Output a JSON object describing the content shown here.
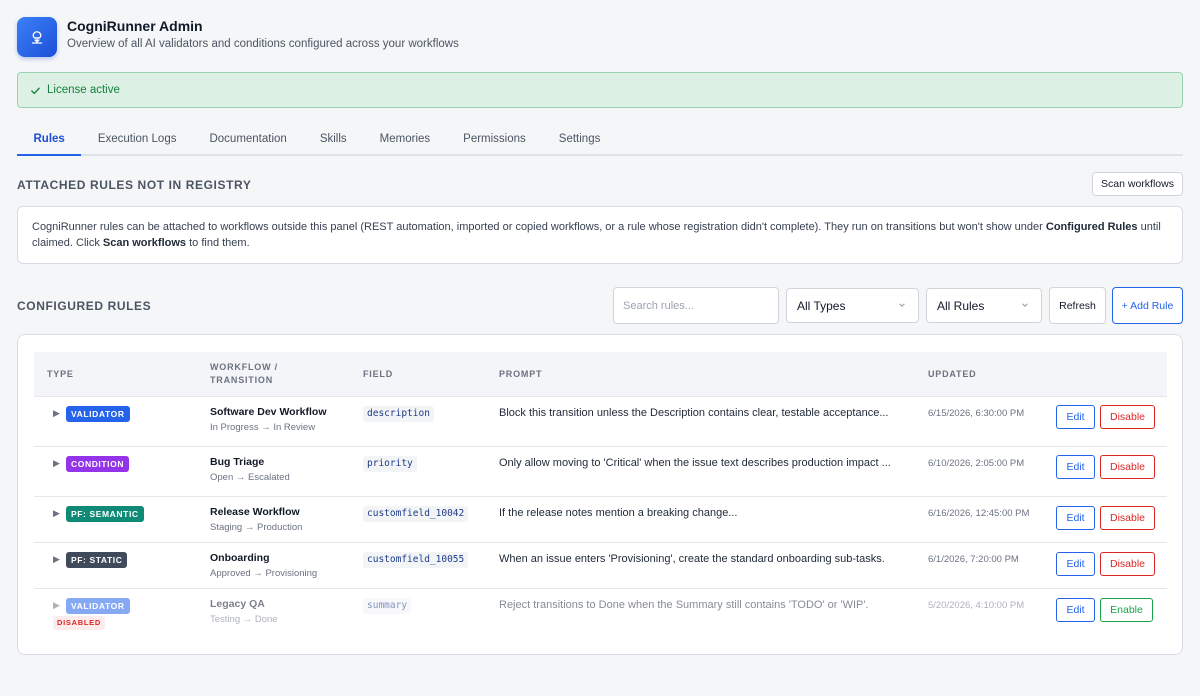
{
  "app": {
    "title": "CogniRunner Admin",
    "subtitle": "Overview of all AI validators and conditions configured across your workflows"
  },
  "license": {
    "text": "License active",
    "color": "#15803d"
  },
  "tabs": [
    {
      "label": "Rules",
      "active": true
    },
    {
      "label": "Execution Logs"
    },
    {
      "label": "Documentation"
    },
    {
      "label": "Skills"
    },
    {
      "label": "Memories"
    },
    {
      "label": "Permissions"
    },
    {
      "label": "Settings"
    }
  ],
  "attached": {
    "title": "ATTACHED RULES NOT IN REGISTRY",
    "scan_button": "Scan workflows",
    "info_part1": "CogniRunner rules can be attached to workflows outside this panel (REST automation, imported or copied workflows, or a rule whose registration didn't complete). They run on transitions but won't show under ",
    "info_bold1": "Configured Rules",
    "info_part2": " until claimed. Click ",
    "info_bold2": "Scan workflows",
    "info_part3": " to find them."
  },
  "configured": {
    "title": "CONFIGURED RULES",
    "search_placeholder": "Search rules...",
    "type_filter": "All Types",
    "rule_filter": "All Rules",
    "refresh_button": "Refresh",
    "add_button": "+ Add Rule",
    "accent_color": "#2563eb"
  },
  "table": {
    "headers": {
      "type": "TYPE",
      "workflow_line1": "WORKFLOW /",
      "workflow_line2": "TRANSITION",
      "field": "FIELD",
      "prompt": "PROMPT",
      "updated": "UPDATED"
    },
    "rows": [
      {
        "type": "VALIDATOR",
        "type_color": "#2563eb",
        "workflow": "Software Dev Workflow",
        "transition": "In Progress → In Review",
        "field": "description",
        "prompt": "Block this transition unless the Description contains clear, testable acceptance...",
        "updated": "6/15/2026, 6:30:00 PM",
        "edit": "Edit",
        "action": "Disable"
      },
      {
        "type": "CONDITION",
        "type_color": "#9333ea",
        "workflow": "Bug Triage",
        "transition": "Open → Escalated",
        "field": "priority",
        "prompt": "Only allow moving to 'Critical' when the issue text describes production impact ...",
        "updated": "6/10/2026, 2:05:00 PM",
        "edit": "Edit",
        "action": "Disable"
      },
      {
        "type": "PF: SEMANTIC",
        "type_color": "#0f8a76",
        "workflow": "Release Workflow",
        "transition": "Staging → Production",
        "field": "customfield_10042",
        "prompt": "If the release notes mention a breaking change...",
        "updated": "6/16/2026, 12:45:00 PM",
        "edit": "Edit",
        "action": "Disable"
      },
      {
        "type": "PF: STATIC",
        "type_color": "#3f4a5a",
        "workflow": "Onboarding",
        "transition": "Approved → Provisioning",
        "field": "customfield_10055",
        "prompt": "When an issue enters 'Provisioning', create the standard onboarding sub-tasks.",
        "updated": "6/1/2026, 7:20:00 PM",
        "edit": "Edit",
        "action": "Disable"
      },
      {
        "type": "VALIDATOR",
        "type_color": "#2563eb",
        "disabled_label": "DISABLED",
        "workflow": "Legacy QA",
        "transition": "Testing → Done",
        "field": "summary",
        "prompt": "Reject transitions to Done when the Summary still contains 'TODO' or 'WIP'.",
        "updated": "5/20/2026, 4:10:00 PM",
        "edit": "Edit",
        "action": "Enable"
      }
    ]
  }
}
